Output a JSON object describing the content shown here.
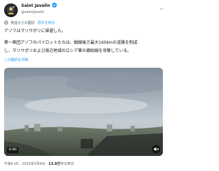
{
  "author": {
    "display_name": "Saint Javelin",
    "handle": "@saintjavelin"
  },
  "translation": {
    "translated_label": "英語からの翻訳",
    "show_original": "原文を表示",
    "rate_label": "この翻訳を評価"
  },
  "tweet": {
    "line1": "アゾフはマリウポリに帰還した。",
    "line2": "第一華団アゾフのパイロットたちは、戦線後方最大160kmの道路を制成",
    "line3": "し、マリウポリおよび周辺地域のロシア軍の補給線を攻撃している。"
  },
  "video": {
    "timestamp": "0:40"
  },
  "meta": {
    "time": "午後6:05",
    "separator": "·",
    "date": "2026年5月8日",
    "views_count": "13.9万",
    "views_label": "件の表示"
  },
  "colors": {
    "accent": "#1d9bf0",
    "secondary_text": "#536471",
    "primary_text": "#0f1419"
  },
  "icons": {
    "avatar": "saint-javelin-avatar",
    "verified": "verified-badge-icon",
    "more": "more-options-icon",
    "translate": "globe-icon",
    "mute": "speaker-muted-icon"
  }
}
